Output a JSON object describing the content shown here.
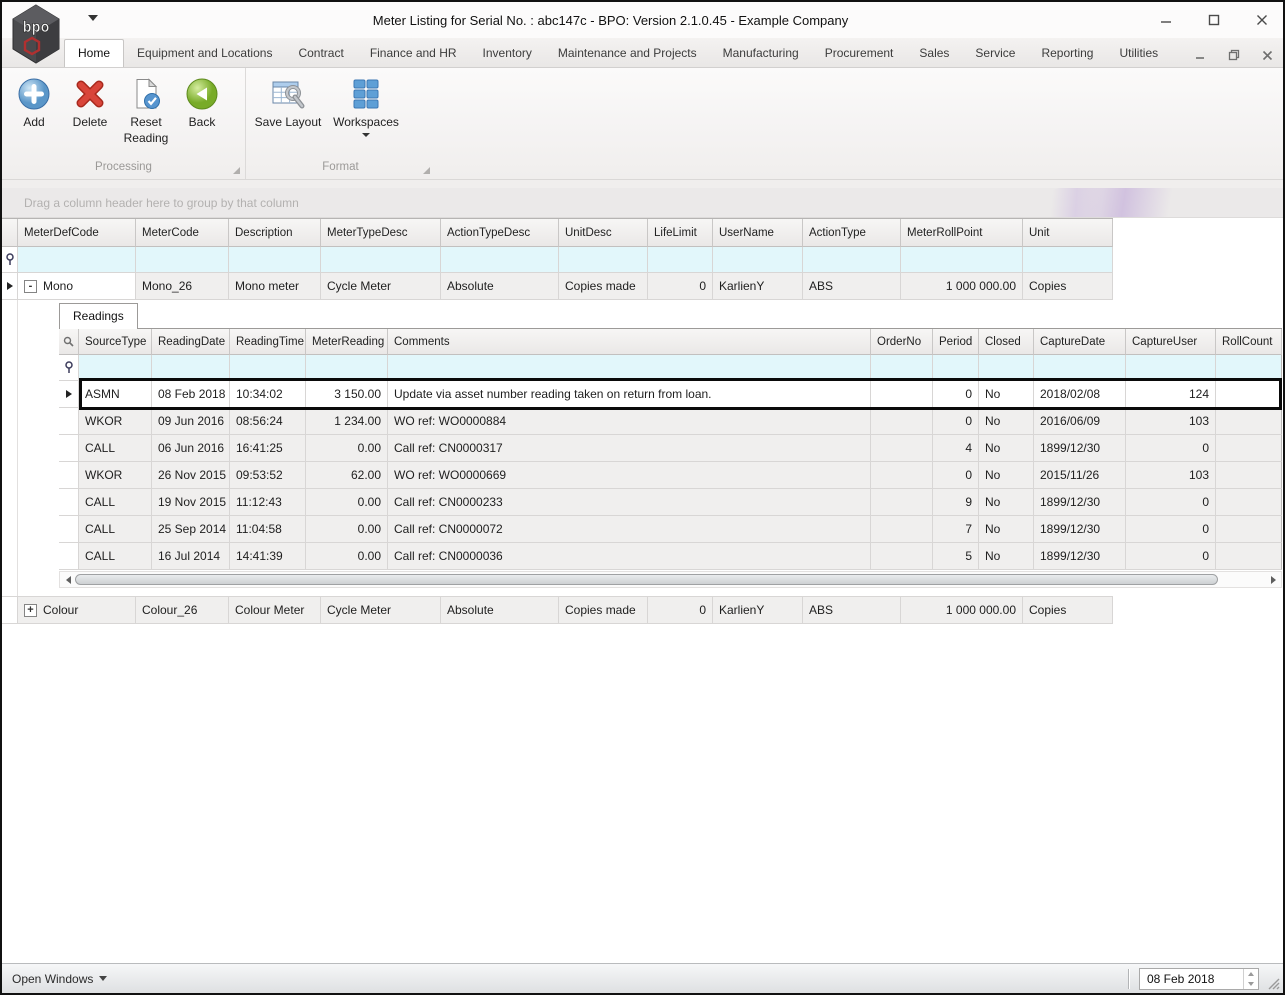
{
  "window": {
    "title": "Meter Listing for Serial No. : abc147c - BPO: Version 2.1.0.45 - Example Company",
    "logo_text": "bpo"
  },
  "ribbon": {
    "tabs": [
      {
        "label": "Home"
      },
      {
        "label": "Equipment and Locations"
      },
      {
        "label": "Contract"
      },
      {
        "label": "Finance and HR"
      },
      {
        "label": "Inventory"
      },
      {
        "label": "Maintenance and Projects"
      },
      {
        "label": "Manufacturing"
      },
      {
        "label": "Procurement"
      },
      {
        "label": "Sales"
      },
      {
        "label": "Service"
      },
      {
        "label": "Reporting"
      },
      {
        "label": "Utilities"
      }
    ],
    "buttons": {
      "add": "Add",
      "delete": "Delete",
      "reset_reading": "Reset\nReading",
      "back": "Back",
      "save_layout": "Save Layout",
      "workspaces": "Workspaces"
    },
    "groups": {
      "processing": "Processing",
      "format": "Format"
    }
  },
  "grid": {
    "group_by_hint": "Drag a column header here to group by that column",
    "columns": [
      "MeterDefCode",
      "MeterCode",
      "Description",
      "MeterTypeDesc",
      "ActionTypeDesc",
      "UnitDesc",
      "LifeLimit",
      "UserName",
      "ActionType",
      "MeterRollPoint",
      "Unit"
    ],
    "rows": [
      {
        "expand_state": "-",
        "MeterDefCode": "Mono",
        "MeterCode": "Mono_26",
        "Description": "Mono meter",
        "MeterTypeDesc": "Cycle Meter",
        "ActionTypeDesc": "Absolute",
        "UnitDesc": "Copies made",
        "LifeLimit": "0",
        "UserName": "KarlienY",
        "ActionType": "ABS",
        "MeterRollPoint": "1 000 000.00",
        "Unit": "Copies"
      },
      {
        "expand_state": "+",
        "MeterDefCode": "Colour",
        "MeterCode": "Colour_26",
        "Description": "Colour Meter",
        "MeterTypeDesc": "Cycle Meter",
        "ActionTypeDesc": "Absolute",
        "UnitDesc": "Copies made",
        "LifeLimit": "0",
        "UserName": "KarlienY",
        "ActionType": "ABS",
        "MeterRollPoint": "1 000 000.00",
        "Unit": "Copies"
      }
    ]
  },
  "readings": {
    "tab_label": "Readings",
    "columns": [
      "SourceType",
      "ReadingDate",
      "ReadingTime",
      "MeterReading",
      "Comments",
      "OrderNo",
      "Period",
      "Closed",
      "CaptureDate",
      "CaptureUser",
      "RollCount"
    ],
    "rows": [
      {
        "SourceType": "ASMN",
        "ReadingDate": "08 Feb 2018",
        "ReadingTime": "10:34:02",
        "MeterReading": "3 150.00",
        "Comments": "Update via asset number reading taken on return from loan.",
        "OrderNo": "",
        "Period": "0",
        "Closed": "No",
        "CaptureDate": "2018/02/08",
        "CaptureUser": "124",
        "RollCount": ""
      },
      {
        "SourceType": "WKOR",
        "ReadingDate": "09 Jun 2016",
        "ReadingTime": "08:56:24",
        "MeterReading": "1 234.00",
        "Comments": "WO ref: WO0000884",
        "OrderNo": "",
        "Period": "0",
        "Closed": "No",
        "CaptureDate": "2016/06/09",
        "CaptureUser": "103",
        "RollCount": ""
      },
      {
        "SourceType": "CALL",
        "ReadingDate": "06 Jun 2016",
        "ReadingTime": "16:41:25",
        "MeterReading": "0.00",
        "Comments": "Call ref: CN0000317",
        "OrderNo": "",
        "Period": "4",
        "Closed": "No",
        "CaptureDate": "1899/12/30",
        "CaptureUser": "0",
        "RollCount": ""
      },
      {
        "SourceType": "WKOR",
        "ReadingDate": "26 Nov 2015",
        "ReadingTime": "09:53:52",
        "MeterReading": "62.00",
        "Comments": "WO ref: WO0000669",
        "OrderNo": "",
        "Period": "0",
        "Closed": "No",
        "CaptureDate": "2015/11/26",
        "CaptureUser": "103",
        "RollCount": ""
      },
      {
        "SourceType": "CALL",
        "ReadingDate": "19 Nov 2015",
        "ReadingTime": "11:12:43",
        "MeterReading": "0.00",
        "Comments": "Call ref: CN0000233",
        "OrderNo": "",
        "Period": "9",
        "Closed": "No",
        "CaptureDate": "1899/12/30",
        "CaptureUser": "0",
        "RollCount": ""
      },
      {
        "SourceType": "CALL",
        "ReadingDate": "25 Sep 2014",
        "ReadingTime": "11:04:58",
        "MeterReading": "0.00",
        "Comments": "Call ref: CN0000072",
        "OrderNo": "",
        "Period": "7",
        "Closed": "No",
        "CaptureDate": "1899/12/30",
        "CaptureUser": "0",
        "RollCount": ""
      },
      {
        "SourceType": "CALL",
        "ReadingDate": "16 Jul 2014",
        "ReadingTime": "14:41:39",
        "MeterReading": "0.00",
        "Comments": "Call ref: CN0000036",
        "OrderNo": "",
        "Period": "5",
        "Closed": "No",
        "CaptureDate": "1899/12/30",
        "CaptureUser": "0",
        "RollCount": ""
      }
    ]
  },
  "statusbar": {
    "open_windows_label": "Open Windows",
    "date_value": "08 Feb 2018"
  }
}
